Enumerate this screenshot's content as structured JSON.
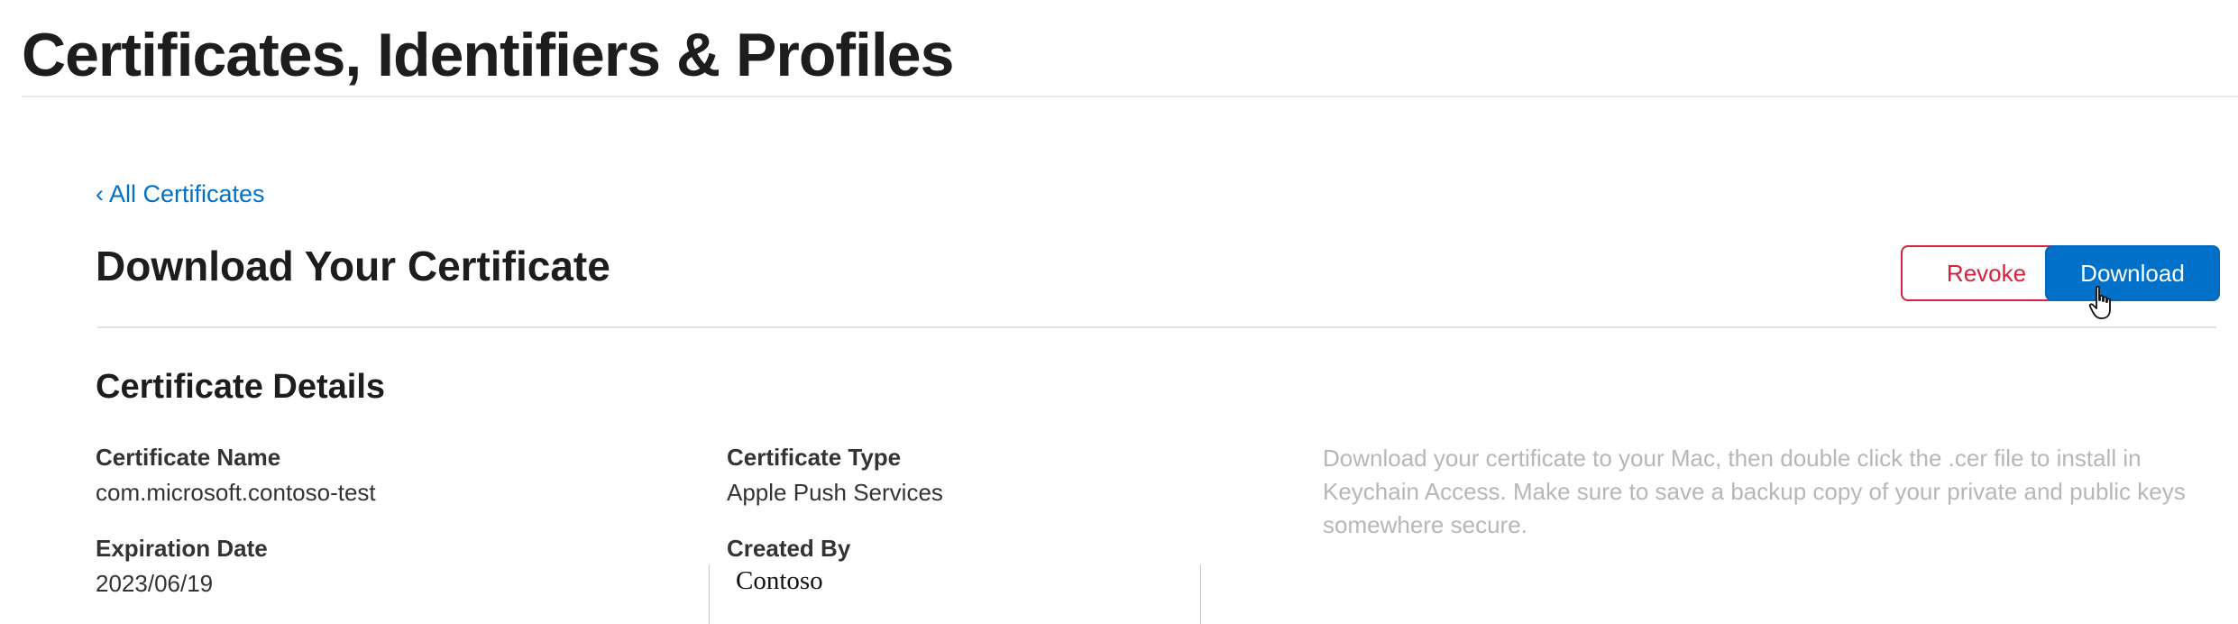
{
  "header": {
    "title": "Certificates, Identifiers & Profiles"
  },
  "nav": {
    "back_chevron": "‹",
    "back_label": "All Certificates"
  },
  "page": {
    "heading": "Download Your Certificate"
  },
  "actions": {
    "revoke_label": "Revoke",
    "download_label": "Download"
  },
  "details": {
    "heading": "Certificate Details",
    "name_label": "Certificate Name",
    "name_value": "com.microsoft.contoso-test",
    "type_label": "Certificate Type",
    "type_value": "Apple Push Services",
    "expiration_label": "Expiration Date",
    "expiration_value": "2023/06/19",
    "created_by_label": "Created By",
    "created_by_value": "Contoso"
  },
  "info": {
    "text": "Download your certificate to your Mac, then double click the .cer file to install in Keychain Access. Make sure to save a backup copy of your private and public keys somewhere secure."
  },
  "colors": {
    "link": "#0070c9",
    "primary_button": "#0070c9",
    "destructive": "#d6223c",
    "info_text": "#b6b6bb"
  },
  "icons": {
    "cursor": "hand-pointer-icon"
  }
}
